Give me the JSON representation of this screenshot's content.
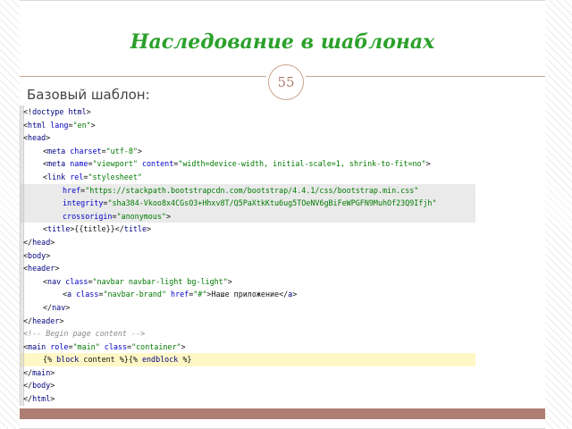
{
  "slide": {
    "title": "Наследование в шаблонах",
    "number": "55",
    "subtitle": "Базовый шаблон:"
  },
  "code": [
    {
      "indent": 0,
      "tokens": [
        [
          "p",
          "<!"
        ],
        [
          "d",
          "doctype"
        ],
        [
          "p",
          " "
        ],
        [
          "t",
          "html"
        ],
        [
          "p",
          ">"
        ]
      ]
    },
    {
      "indent": 0,
      "tokens": [
        [
          "p",
          "<"
        ],
        [
          "t",
          "html"
        ],
        [
          "p",
          " "
        ],
        [
          "a",
          "lang"
        ],
        [
          "p",
          "="
        ],
        [
          "s",
          "\"en\""
        ],
        [
          "p",
          ">"
        ]
      ]
    },
    {
      "indent": 0,
      "tokens": [
        [
          "p",
          "<"
        ],
        [
          "t",
          "head"
        ],
        [
          "p",
          ">"
        ]
      ]
    },
    {
      "indent": 1,
      "tokens": [
        [
          "p",
          "<"
        ],
        [
          "t",
          "meta"
        ],
        [
          "p",
          " "
        ],
        [
          "a",
          "charset"
        ],
        [
          "p",
          "="
        ],
        [
          "s",
          "\"utf-8\""
        ],
        [
          "p",
          ">"
        ]
      ]
    },
    {
      "indent": 1,
      "tokens": [
        [
          "p",
          "<"
        ],
        [
          "t",
          "meta"
        ],
        [
          "p",
          " "
        ],
        [
          "a",
          "name"
        ],
        [
          "p",
          "="
        ],
        [
          "s",
          "\"viewport\""
        ],
        [
          "p",
          " "
        ],
        [
          "a",
          "content"
        ],
        [
          "p",
          "="
        ],
        [
          "s",
          "\"width=device-width, initial-scale=1, shrink-to-fit=no\""
        ],
        [
          "p",
          ">"
        ]
      ]
    },
    {
      "indent": 1,
      "tokens": [
        [
          "p",
          "<"
        ],
        [
          "t",
          "link"
        ],
        [
          "p",
          " "
        ],
        [
          "a",
          "rel"
        ],
        [
          "p",
          "="
        ],
        [
          "s",
          "\"stylesheet\""
        ]
      ]
    },
    {
      "indent": 2,
      "gray": true,
      "tokens": [
        [
          "a",
          "href"
        ],
        [
          "p",
          "="
        ],
        [
          "s",
          "\"https://stackpath.bootstrapcdn.com/bootstrap/4.4.1/css/bootstrap.min.css\""
        ]
      ]
    },
    {
      "indent": 2,
      "gray": true,
      "tokens": [
        [
          "a",
          "integrity"
        ],
        [
          "p",
          "="
        ],
        [
          "s",
          "\"sha384-Vkoo8x4CGsO3+Hhxv8T/Q5PaXtkKtu6ug5TOeNV6gBiFeWPGFN9MuhOf23Q9Ifjh\""
        ]
      ]
    },
    {
      "indent": 2,
      "gray": true,
      "tokens": [
        [
          "a",
          "crossorigin"
        ],
        [
          "p",
          "="
        ],
        [
          "s",
          "\"anonymous\""
        ],
        [
          "p",
          ">"
        ]
      ]
    },
    {
      "indent": 1,
      "tokens": [
        [
          "p",
          "<"
        ],
        [
          "t",
          "title"
        ],
        [
          "p",
          ">{{title}}</"
        ],
        [
          "t",
          "title"
        ],
        [
          "p",
          ">"
        ]
      ]
    },
    {
      "indent": 0,
      "tokens": [
        [
          "p",
          "</"
        ],
        [
          "t",
          "head"
        ],
        [
          "p",
          ">"
        ]
      ]
    },
    {
      "indent": 0,
      "tokens": [
        [
          "p",
          "<"
        ],
        [
          "t",
          "body"
        ],
        [
          "p",
          ">"
        ]
      ]
    },
    {
      "indent": 0,
      "tokens": [
        [
          "p",
          "<"
        ],
        [
          "t",
          "header"
        ],
        [
          "p",
          ">"
        ]
      ]
    },
    {
      "indent": 1,
      "tokens": [
        [
          "p",
          "<"
        ],
        [
          "t",
          "nav"
        ],
        [
          "p",
          " "
        ],
        [
          "a",
          "class"
        ],
        [
          "p",
          "="
        ],
        [
          "s",
          "\"navbar navbar-light bg-light\""
        ],
        [
          "p",
          ">"
        ]
      ]
    },
    {
      "indent": 2,
      "tokens": [
        [
          "p",
          "<"
        ],
        [
          "t",
          "a"
        ],
        [
          "p",
          " "
        ],
        [
          "a",
          "class"
        ],
        [
          "p",
          "="
        ],
        [
          "s",
          "\"navbar-brand\""
        ],
        [
          "p",
          " "
        ],
        [
          "a",
          "href"
        ],
        [
          "p",
          "="
        ],
        [
          "s",
          "\"#\""
        ],
        [
          "p",
          ">Наше приложение</"
        ],
        [
          "t",
          "a"
        ],
        [
          "p",
          ">"
        ]
      ]
    },
    {
      "indent": 1,
      "tokens": [
        [
          "p",
          "</"
        ],
        [
          "t",
          "nav"
        ],
        [
          "p",
          ">"
        ]
      ]
    },
    {
      "indent": 0,
      "tokens": [
        [
          "p",
          "</"
        ],
        [
          "t",
          "header"
        ],
        [
          "p",
          ">"
        ]
      ]
    },
    {
      "indent": 0,
      "tokens": [
        [
          "c",
          "<!-- Begin page content -->"
        ]
      ]
    },
    {
      "indent": 0,
      "tokens": [
        [
          "p",
          "<"
        ],
        [
          "t",
          "main"
        ],
        [
          "p",
          " "
        ],
        [
          "a",
          "role"
        ],
        [
          "p",
          "="
        ],
        [
          "s",
          "\"main\""
        ],
        [
          "p",
          " "
        ],
        [
          "a",
          "class"
        ],
        [
          "p",
          "="
        ],
        [
          "s",
          "\"container\""
        ],
        [
          "p",
          ">"
        ]
      ]
    },
    {
      "indent": 1,
      "hl": true,
      "tokens": [
        [
          "p",
          "{% "
        ],
        [
          "t",
          "block"
        ],
        [
          "p",
          " content %}{% "
        ],
        [
          "t",
          "endblock"
        ],
        [
          "p",
          " %}"
        ]
      ]
    },
    {
      "indent": 0,
      "tokens": [
        [
          "p",
          "</"
        ],
        [
          "t",
          "main"
        ],
        [
          "p",
          ">"
        ]
      ]
    },
    {
      "indent": 0,
      "tokens": [
        [
          "p",
          "</"
        ],
        [
          "t",
          "body"
        ],
        [
          "p",
          ">"
        ]
      ]
    },
    {
      "indent": 0,
      "tokens": [
        [
          "p",
          "</"
        ],
        [
          "t",
          "html"
        ],
        [
          "p",
          ">"
        ]
      ]
    }
  ]
}
